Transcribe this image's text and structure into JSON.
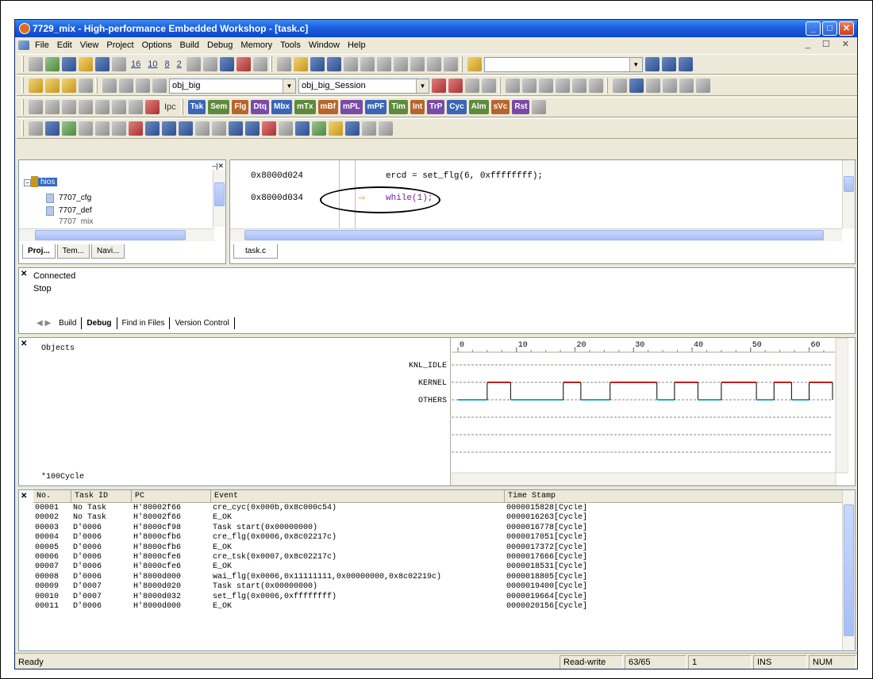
{
  "window": {
    "title": "7729_mix - High-performance Embedded Workshop - [task.c]",
    "minimize_glyph": "_",
    "maximize_glyph": "□",
    "close_glyph": "✕"
  },
  "menu": [
    "File",
    "Edit",
    "View",
    "Project",
    "Options",
    "Build",
    "Debug",
    "Memory",
    "Tools",
    "Window",
    "Help"
  ],
  "menu_mdi": "_ ☐ ✕",
  "toolbar1": {
    "nums": [
      "16",
      "10",
      "8",
      "2"
    ]
  },
  "toolbar2": {
    "config_combo": "obj_big",
    "session_combo": "obj_big_Session"
  },
  "toolbar3": {
    "pc_label": "Ipc",
    "labels": [
      "Tsk",
      "Sem",
      "Flg",
      "Dtq",
      "Mbx",
      "mTx",
      "mBf",
      "mPL",
      "mPF",
      "Tim",
      "Int",
      "TrP",
      "Cyc",
      "Alm",
      "sVc",
      "Rst"
    ]
  },
  "tree": {
    "root": "hios",
    "items": [
      "7707_cfg",
      "7707_def",
      "7707_mix"
    ],
    "tabs": [
      "Proj...",
      "Tem...",
      "Navi..."
    ]
  },
  "source": {
    "rows": [
      {
        "addr": "0x8000d024",
        "code": "ercd = set_flg(6, 0xffffffff);"
      },
      {
        "addr": "0x8000d034",
        "code": "while(1);"
      }
    ],
    "file_tab": "task.c"
  },
  "output": {
    "lines": [
      "Connected",
      "Stop"
    ],
    "tabs": [
      "Build",
      "Debug",
      "Find in Files",
      "Version Control"
    ]
  },
  "perf": {
    "objects_header": "Objects",
    "rows": [
      "KNL_IDLE",
      "KERNEL",
      "OTHERS"
    ],
    "footer": "*100Cycle",
    "axis_ticks": [
      "0",
      "10",
      "20",
      "30",
      "40",
      "50",
      "60"
    ],
    "axis": {
      "min": 0,
      "max": 64
    },
    "kernel_on": [
      [
        5,
        9
      ],
      [
        18,
        21
      ],
      [
        26,
        34
      ],
      [
        37,
        41
      ],
      [
        45,
        51
      ],
      [
        54,
        57
      ],
      [
        60,
        64
      ]
    ],
    "kernel_color": "#c02020",
    "others_color": "#20a8d0"
  },
  "trace": {
    "headers": [
      "No.",
      "Task ID",
      "PC",
      "Event",
      "Time Stamp"
    ],
    "rows": [
      [
        "00001",
        "No Task",
        "H'80002f66",
        "cre_cyc(0x000b,0x8c000c54)",
        "0000015828[Cycle]"
      ],
      [
        "00002",
        "No Task",
        "H'80002f66",
        "E_OK",
        "0000016263[Cycle]"
      ],
      [
        "00003",
        "D'0006",
        "H'8000cf98",
        "Task start(0x00000000)",
        "0000016778[Cycle]"
      ],
      [
        "00004",
        "D'0006",
        "H'8000cfb6",
        "cre_flg(0x0006,0x8c02217c)",
        "0000017051[Cycle]"
      ],
      [
        "00005",
        "D'0006",
        "H'8000cfb6",
        "E_OK",
        "0000017372[Cycle]"
      ],
      [
        "00006",
        "D'0006",
        "H'8000cfe6",
        "cre_tsk(0x0007,0x8c02217c)",
        "0000017666[Cycle]"
      ],
      [
        "00007",
        "D'0006",
        "H'8000cfe6",
        "E_OK",
        "0000018531[Cycle]"
      ],
      [
        "00008",
        "D'0006",
        "H'8000d000",
        "wai_flg(0x0006,0x11111111,0x00000000,0x8c02219c)",
        "0000018805[Cycle]"
      ],
      [
        "00009",
        "D'0007",
        "H'8000d020",
        "Task start(0x00000000)",
        "0000019400[Cycle]"
      ],
      [
        "00010",
        "D'0007",
        "H'8000d032",
        "set_flg(0x0006,0xffffffff)",
        "0000019664[Cycle]"
      ],
      [
        "00011",
        "D'0006",
        "H'8000d000",
        "E_OK",
        "0000020156[Cycle]"
      ]
    ]
  },
  "status": {
    "ready": "Ready",
    "mode": "Read-write",
    "pos": "63/65",
    "col": "1",
    "ins": "INS",
    "num": "NUM"
  }
}
